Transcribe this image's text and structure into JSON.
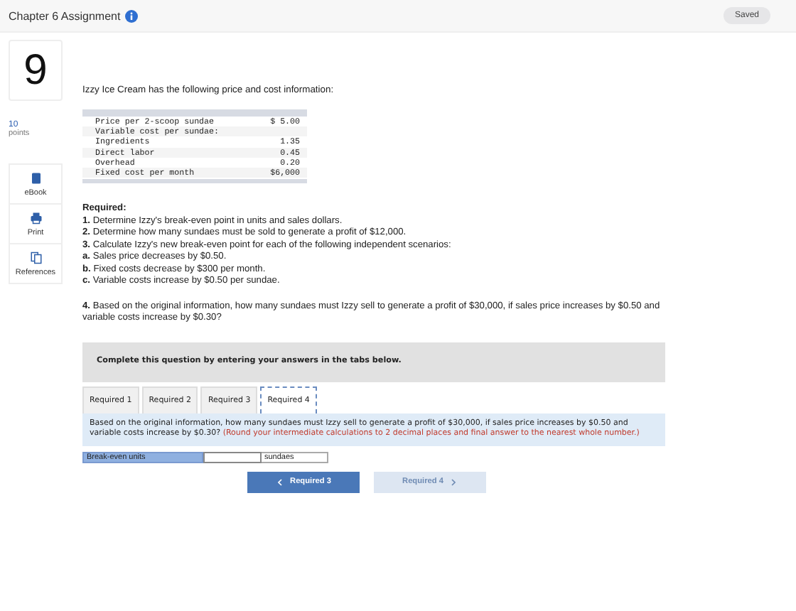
{
  "header": {
    "title": "Chapter 6 Assignment",
    "status": "Saved"
  },
  "question": {
    "number": "9",
    "points": "10",
    "points_label": "points"
  },
  "tools": [
    {
      "label": "eBook",
      "kind": "book"
    },
    {
      "label": "Print",
      "kind": "print"
    },
    {
      "label": "References",
      "kind": "copy"
    }
  ],
  "intro": "Izzy Ice Cream has the following price and cost information:",
  "cost_table": [
    {
      "label": "Price per 2-scoop sundae",
      "value": "$ 5.00"
    },
    {
      "label": "Variable cost per sundae:"
    },
    {
      "label": "Ingredients",
      "value": "1.35"
    },
    {
      "label": "Direct labor",
      "value": "0.45"
    },
    {
      "label": "Overhead",
      "value": "0.20"
    },
    {
      "label": "Fixed cost per month",
      "value": "$6,000"
    }
  ],
  "required_title": "Required:",
  "required_items": [
    "**1.** Determine Izzy's break-even point in units and sales dollars.",
    "**2.** Determine how many sundaes must be sold to generate a profit of $12,000.",
    "**3.** Calculate Izzy's new break-even point for each of the following independent scenarios:",
    "**a.** Sales price decreases by $0.50.",
    "**b.** Fixed costs decrease by $300 per month.",
    "**c.** Variable costs increase by $0.50 per sundae."
  ],
  "question_4": "**4.** Based on the original information, how many sundaes must Izzy sell to generate a profit of $30,000, if sales price increases by $0.50 and variable costs increase by $0.30?",
  "banner": "Complete this question by entering your answers in the tabs below.",
  "tabs": [
    {
      "label": "Required 1",
      "selected": false
    },
    {
      "label": "Required 2",
      "selected": false
    },
    {
      "label": "Required 3",
      "selected": false
    },
    {
      "label": "Required 4",
      "selected": true
    }
  ],
  "prompt": "Based on the original information, how many sundaes must Izzy sell to generate a profit of $30,000, if sales price increases by $0.50 and variable costs increase by $0.30?",
  "instruction": "(Round your intermediate calculations to 2 decimal places and final answer to the nearest whole number.)",
  "answer": {
    "label": "Break-even units",
    "unit": "sundaes"
  },
  "nav": [
    {
      "label": "Required 3",
      "kind": "back",
      "disabled": false
    },
    {
      "label": "Required 4",
      "kind": "forward",
      "disabled": true
    }
  ]
}
